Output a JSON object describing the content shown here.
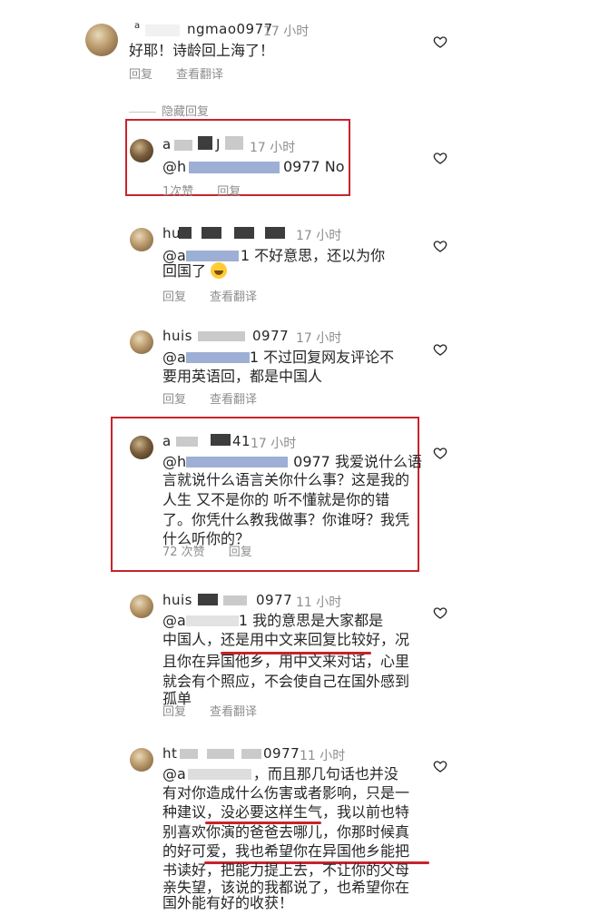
{
  "labels": {
    "reply": "回复",
    "see_translation": "查看翻译",
    "hidden_replies": "隐藏回复"
  },
  "comments": [
    {
      "user_visible": "ngmao0977",
      "user_prefix": "a",
      "time": "17 小时",
      "text": "好耶！诗龄回上海了！"
    },
    {
      "user_prefix": "a",
      "user_suffix": "J",
      "time": "17 小时",
      "mention_prefix": "@h",
      "mention_suffix": "0977 No",
      "likes": "1次赞"
    },
    {
      "user_prefix": "hu",
      "time": "17 小时",
      "mention_prefix": "@a",
      "mention_suffix": "1",
      "text_after": " 不好意思，还以为你",
      "text_line2": "回国了"
    },
    {
      "user_prefix": "huis",
      "user_suffix": "0977",
      "time": "17 小时",
      "mention_prefix": "@a",
      "mention_suffix": "1",
      "text_after": " 不过回复网友评论不",
      "text_line2": "要用英语回，都是中国人"
    },
    {
      "user_prefix": "a",
      "user_suffix": "41",
      "time": "17 小时",
      "mention_prefix": "@h",
      "mention_suffix": "0977",
      "text_after": " 我爱说什么语",
      "lines": [
        "言就说什么语言关你什么事？这是我的",
        "人生 又不是你的 听不懂就是你的错",
        "了。你凭什么教我做事？你谁呀？我凭",
        "什么听你的？"
      ],
      "likes": "72 次赞"
    },
    {
      "user_prefix": "huis",
      "user_suffix": "0977",
      "time": "11 小时",
      "mention_prefix": "@a",
      "mention_suffix": "1",
      "text_after": " 我的意思是大家都是",
      "lines": [
        "中国人，还是用中文来回复比较好，况",
        "且你在异国他乡，用中文来对话，心里",
        "就会有个照应，不会使自己在国外感到",
        "孤单"
      ]
    },
    {
      "user_prefix": "ht",
      "user_suffix": "0977",
      "time": "11 小时",
      "mention_prefix": "@a",
      "text_after": "，而且那几句话也并没",
      "lines": [
        "有对你造成什么伤害或者影响，只是一",
        "种建议，没必要这样生气，我以前也特",
        "别喜欢你演的爸爸去哪儿，你那时候真",
        "的好可爱，我也希望你在异国他乡能把",
        "书读好，把能力提上去，不让你的父母",
        "亲失望，该说的我都说了，也希望你在",
        "国外能有好的收获！"
      ]
    }
  ]
}
